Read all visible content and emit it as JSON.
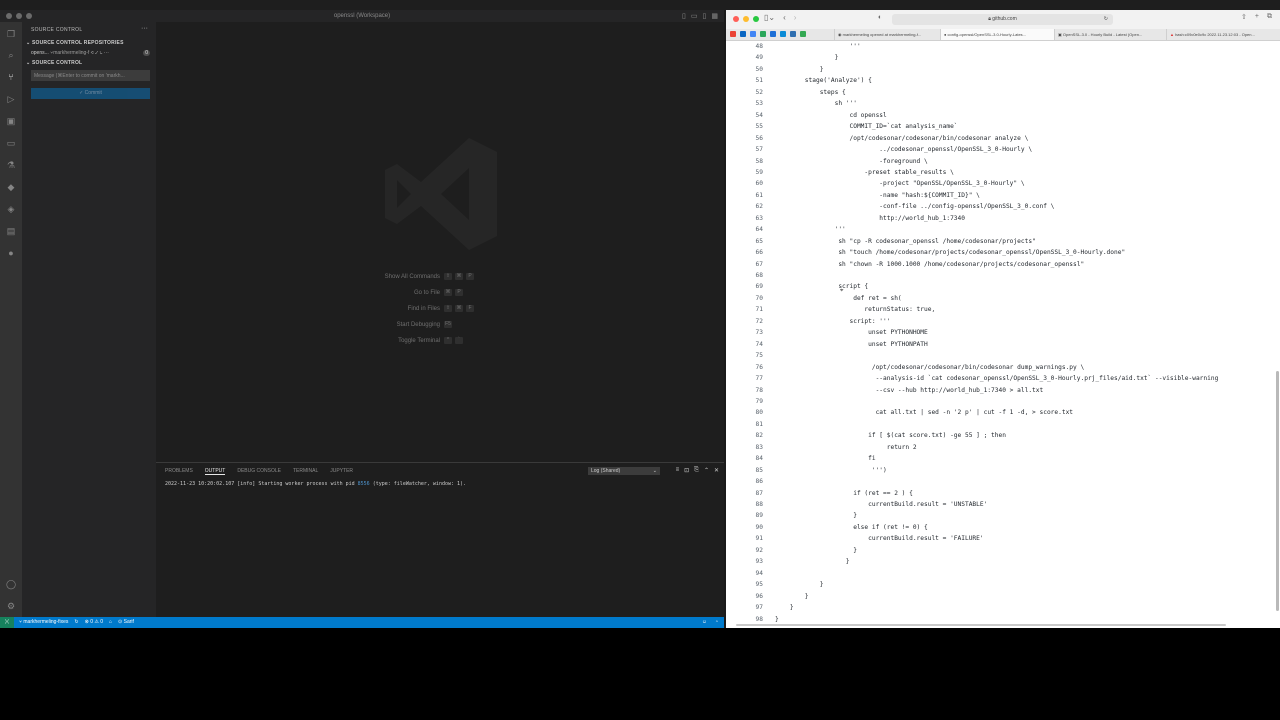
{
  "vscode": {
    "window_title": "openssl (Workspace)",
    "sidebar_title": "SOURCE CONTROL",
    "repos_header": "SOURCE CONTROL REPOSITORIES",
    "repo_name": "opens...",
    "repo_branch": "markhermeling-f",
    "repo_count": "0",
    "sc_header": "SOURCE CONTROL",
    "commit_placeholder": "Message (⌘Enter to commit on 'markh...",
    "commit_label": "✓ Commit",
    "shortcuts": [
      {
        "label": "Show All Commands",
        "keys": [
          "⇧",
          "⌘",
          "P"
        ]
      },
      {
        "label": "Go to File",
        "keys": [
          "⌘",
          "P"
        ]
      },
      {
        "label": "Find in Files",
        "keys": [
          "⇧",
          "⌘",
          "F"
        ]
      },
      {
        "label": "Start Debugging",
        "keys": [
          "F5"
        ]
      },
      {
        "label": "Toggle Terminal",
        "keys": [
          "^",
          "`"
        ]
      }
    ],
    "panel_tabs": [
      "PROBLEMS",
      "OUTPUT",
      "DEBUG CONSOLE",
      "TERMINAL",
      "JUPYTER"
    ],
    "panel_active_tab": "OUTPUT",
    "log_select": "Log (Shared)",
    "output_line_prefix": "2022-11-23 10:20:02.107 [info] Starting worker process with pid ",
    "output_pid": "8556",
    "output_line_suffix": " (type: fileWatcher, window: 1).",
    "status": {
      "branch": "markhermeling-fixes",
      "sync": "↻",
      "problems": "⊗ 0 ⚠ 0",
      "sarif": "Sarif"
    }
  },
  "browser": {
    "address": "github.com",
    "tabs": [
      "markhermeling opened at markhermeling-f...",
      "config-openssl/OpenSSL-3.0-Hourly-Lates...",
      "OpenSSL-3.0 - Hourly Build - Latest (Open...",
      "hash:c09c0e0c9c 2022.11.23.12:03 - Open..."
    ],
    "active_tab_index": 1,
    "code_lines": [
      {
        "n": "48",
        "t": "                    '''"
      },
      {
        "n": "49",
        "t": "                }"
      },
      {
        "n": "50",
        "t": "            }"
      },
      {
        "n": "51",
        "t": "        stage('Analyze') {"
      },
      {
        "n": "52",
        "t": "            steps {"
      },
      {
        "n": "53",
        "t": "                sh '''"
      },
      {
        "n": "54",
        "t": "                    cd openssl"
      },
      {
        "n": "55",
        "t": "                    COMMIT_ID=`cat analysis_name`"
      },
      {
        "n": "56",
        "t": "                    /opt/codesonar/codesonar/bin/codesonar analyze \\"
      },
      {
        "n": "57",
        "t": "                            ../codesonar_openssl/OpenSSL_3_0-Hourly \\"
      },
      {
        "n": "58",
        "t": "                            -foreground \\"
      },
      {
        "n": "59",
        "t": "                        -preset stable_results \\"
      },
      {
        "n": "60",
        "t": "                            -project \"OpenSSL/OpenSSL_3_0-Hourly\" \\"
      },
      {
        "n": "61",
        "t": "                            -name \"hash:${COMMIT_ID}\" \\"
      },
      {
        "n": "62",
        "t": "                            -conf-file ../config-openssl/OpenSSL_3_0.conf \\"
      },
      {
        "n": "63",
        "t": "                            http://world_hub_1:7340"
      },
      {
        "n": "64",
        "t": "                '''"
      },
      {
        "n": "65",
        "t": "                 sh \"cp -R codesonar_openssl /home/codesonar/projects\""
      },
      {
        "n": "66",
        "t": "                 sh \"touch /home/codesonar/projects/codesonar_openssl/OpenSSL_3_0-Hourly.done\""
      },
      {
        "n": "67",
        "t": "                 sh \"chown -R 1000.1000 /home/codesonar/projects/codesonar_openssl\""
      },
      {
        "n": "68",
        "t": ""
      },
      {
        "n": "69",
        "t": "                 script {"
      },
      {
        "n": "70",
        "t": "                     def ret = sh("
      },
      {
        "n": "71",
        "t": "                        returnStatus: true,"
      },
      {
        "n": "72",
        "t": "                    script: '''"
      },
      {
        "n": "73",
        "t": "                         unset PYTHONHOME"
      },
      {
        "n": "74",
        "t": "                         unset PYTHONPATH"
      },
      {
        "n": "75",
        "t": ""
      },
      {
        "n": "76",
        "t": "                          /opt/codesonar/codesonar/bin/codesonar dump_warnings.py \\"
      },
      {
        "n": "77",
        "t": "                           --analysis-id `cat codesonar_openssl/OpenSSL_3_0-Hourly.prj_files/aid.txt` --visible-warning"
      },
      {
        "n": "78",
        "t": "                           --csv --hub http://world_hub_1:7340 > all.txt"
      },
      {
        "n": "79",
        "t": ""
      },
      {
        "n": "80",
        "t": "                           cat all.txt | sed -n '2 p' | cut -f 1 -d, > score.txt"
      },
      {
        "n": "81",
        "t": ""
      },
      {
        "n": "82",
        "t": "                         if [ $(cat score.txt) -ge 55 ] ; then"
      },
      {
        "n": "83",
        "t": "                              return 2"
      },
      {
        "n": "84",
        "t": "                         fi"
      },
      {
        "n": "85",
        "t": "                          ''')"
      },
      {
        "n": "86",
        "t": ""
      },
      {
        "n": "87",
        "t": "                     if (ret == 2 ) {"
      },
      {
        "n": "88",
        "t": "                         currentBuild.result = 'UNSTABLE'"
      },
      {
        "n": "89",
        "t": "                     }"
      },
      {
        "n": "90",
        "t": "                     else if (ret != 0) {"
      },
      {
        "n": "91",
        "t": "                         currentBuild.result = 'FAILURE'"
      },
      {
        "n": "92",
        "t": "                     }"
      },
      {
        "n": "93",
        "t": "                   }"
      },
      {
        "n": "94",
        "t": ""
      },
      {
        "n": "95",
        "t": "            }"
      },
      {
        "n": "96",
        "t": "        }"
      },
      {
        "n": "97",
        "t": "    }"
      },
      {
        "n": "98",
        "t": "}"
      }
    ]
  },
  "colors": {
    "vscode_bg": "#1e1e1e",
    "statusbar": "#007acc",
    "activity_bar": "#333333",
    "sidebar": "#252526"
  }
}
